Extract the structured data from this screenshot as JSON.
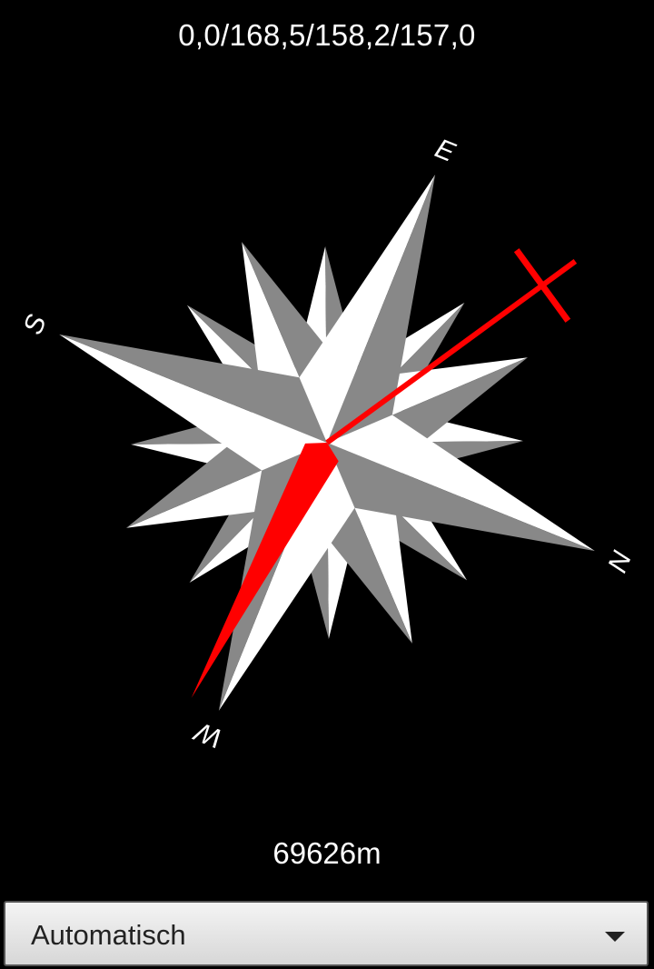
{
  "header": {
    "orientation_readout": "0,0/168,5/158,2/157,0"
  },
  "compass": {
    "label_n": "N",
    "label_e": "E",
    "label_s": "S",
    "label_w": "W",
    "needle_color": "#ff0000",
    "target_color": "#ff0000",
    "rose_light": "#ffffff",
    "rose_dark": "#888888"
  },
  "footer": {
    "distance": "69626m"
  },
  "mode_select": {
    "selected": "Automatisch"
  }
}
